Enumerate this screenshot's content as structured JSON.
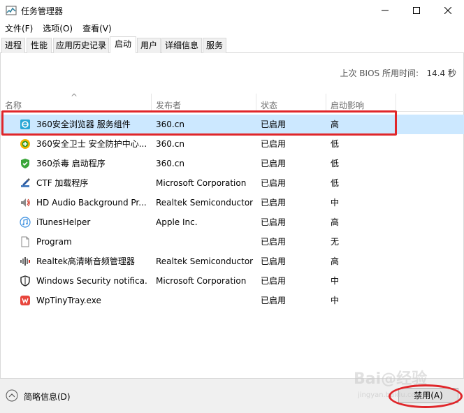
{
  "window": {
    "title": "任务管理器"
  },
  "menu": [
    "文件(F)",
    "选项(O)",
    "查看(V)"
  ],
  "tabs": [
    "进程",
    "性能",
    "应用历史记录",
    "启动",
    "用户",
    "详细信息",
    "服务"
  ],
  "active_tab": "启动",
  "bios": {
    "label": "上次 BIOS 所用时间:",
    "value": "14.4 秒"
  },
  "columns": {
    "name": "名称",
    "publisher": "发布者",
    "status": "状态",
    "impact": "启动影响"
  },
  "rows": [
    {
      "name": "360安全浏览器 服务组件",
      "publisher": "360.cn",
      "status": "已启用",
      "impact": "高",
      "icon": "browser-360-icon"
    },
    {
      "name": "360安全卫士 安全防护中心...",
      "publisher": "360.cn",
      "status": "已启用",
      "impact": "低",
      "icon": "guard-360-icon"
    },
    {
      "name": "360杀毒 启动程序",
      "publisher": "360.cn",
      "status": "已启用",
      "impact": "低",
      "icon": "antivirus-360-icon"
    },
    {
      "name": "CTF 加载程序",
      "publisher": "Microsoft Corporation",
      "status": "已启用",
      "impact": "低",
      "icon": "ctf-icon"
    },
    {
      "name": "HD Audio Background Pr...",
      "publisher": "Realtek Semiconductor",
      "status": "已启用",
      "impact": "中",
      "icon": "speaker-icon"
    },
    {
      "name": "iTunesHelper",
      "publisher": "Apple Inc.",
      "status": "已启用",
      "impact": "高",
      "icon": "itunes-icon"
    },
    {
      "name": "Program",
      "publisher": "",
      "status": "已启用",
      "impact": "无",
      "icon": "blank-file-icon"
    },
    {
      "name": "Realtek高清晰音频管理器",
      "publisher": "Realtek Semiconductor",
      "status": "已启用",
      "impact": "高",
      "icon": "realtek-audio-icon"
    },
    {
      "name": "Windows Security notifica...",
      "publisher": "Microsoft Corporation",
      "status": "已启用",
      "impact": "中",
      "icon": "shield-icon"
    },
    {
      "name": "WpTinyTray.exe",
      "publisher": "",
      "status": "已启用",
      "impact": "中",
      "icon": "wp-tray-icon"
    }
  ],
  "footer": {
    "fewer_details": "简略信息(D)",
    "disable_button": "禁用(A)"
  },
  "watermark": {
    "text": "Bai@经验",
    "sub": "jingyan.baidu.com"
  }
}
